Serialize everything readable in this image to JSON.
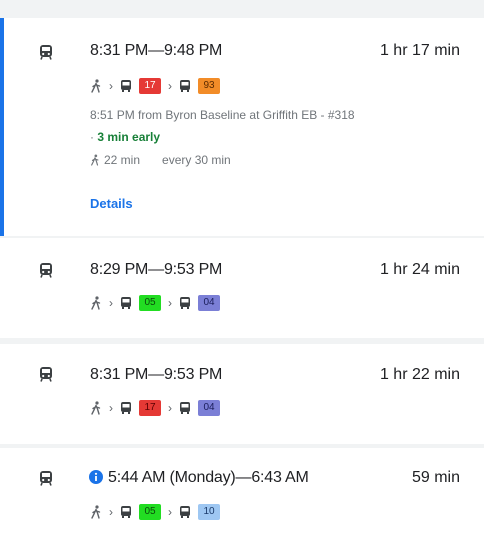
{
  "routes": [
    {
      "times": "8:31 PM—9:48 PM",
      "duration": "1 hr 17 min",
      "legs": [
        {
          "type": "walk"
        },
        {
          "type": "bus",
          "label": "17",
          "bg": "#e53935",
          "fg": "#ffffff"
        },
        {
          "type": "bus",
          "label": "93",
          "bg": "#f28c28",
          "fg": "#5a2a00"
        }
      ],
      "departure": "8:51 PM from Byron Baseline at Griffith EB - #318",
      "status_prefix": "·",
      "status": "3 min early",
      "walk_time": "22 min",
      "frequency": "every 30 min",
      "details_link": "Details"
    },
    {
      "times": "8:29 PM—9:53 PM",
      "duration": "1 hr 24 min",
      "legs": [
        {
          "type": "walk"
        },
        {
          "type": "bus",
          "label": "05",
          "bg": "#22dd22",
          "fg": "#0a4a0a"
        },
        {
          "type": "bus",
          "label": "04",
          "bg": "#7b7fd6",
          "fg": "#1a1d5a"
        }
      ]
    },
    {
      "times": "8:31 PM—9:53 PM",
      "duration": "1 hr 22 min",
      "legs": [
        {
          "type": "walk"
        },
        {
          "type": "bus",
          "label": "17",
          "bg": "#e53935",
          "fg": "#5a0000"
        },
        {
          "type": "bus",
          "label": "04",
          "bg": "#7b7fd6",
          "fg": "#1a1d5a"
        }
      ]
    },
    {
      "times": "5:44 AM (Monday)—6:43 AM",
      "duration": "59 min",
      "legs": [
        {
          "type": "walk"
        },
        {
          "type": "bus",
          "label": "05",
          "bg": "#22dd22",
          "fg": "#0a4a0a"
        },
        {
          "type": "bus",
          "label": "10",
          "bg": "#9ec7f2",
          "fg": "#1a3a6a"
        }
      ]
    }
  ],
  "icons": {
    "transit": "train-icon",
    "walk": "walk-icon",
    "bus": "bus-icon",
    "chevron": "chevron-right-icon",
    "info": "info-icon",
    "accent": "#1a73e8"
  }
}
